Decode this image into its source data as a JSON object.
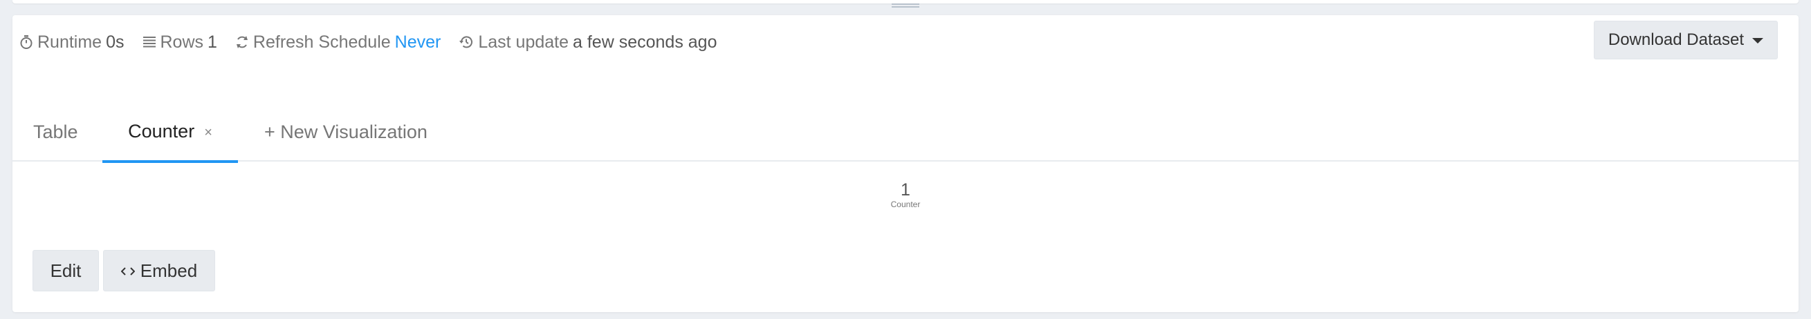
{
  "meta": {
    "runtime_label": "Runtime",
    "runtime_value": "0s",
    "rows_label": "Rows",
    "rows_value": "1",
    "refresh_label": "Refresh Schedule",
    "refresh_value": "Never",
    "last_update_label": "Last update",
    "last_update_value": "a few seconds ago"
  },
  "download": {
    "label": "Download Dataset"
  },
  "tabs": [
    {
      "label": "Table"
    },
    {
      "label": "Counter",
      "active": true,
      "close": "×"
    },
    {
      "label": "+ New Visualization"
    }
  ],
  "counter": {
    "value": "1",
    "label": "Counter"
  },
  "actions": {
    "edit_label": "Edit",
    "embed_label": "Embed"
  },
  "colors": {
    "accent": "#2196f3",
    "button_bg": "#e8ebef",
    "muted_text": "#767676"
  }
}
